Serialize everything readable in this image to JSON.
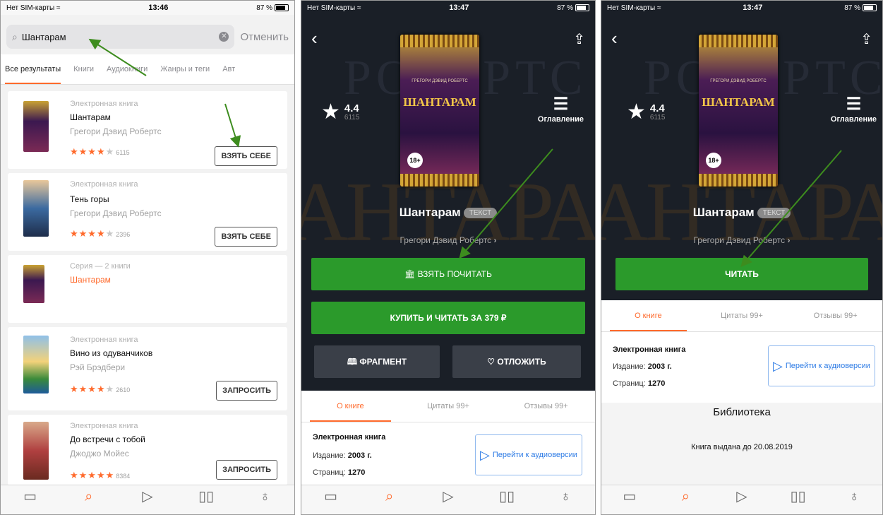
{
  "screen1": {
    "status": {
      "carrier": "Нет SIM-карты",
      "time": "13:46",
      "battery": "87 %"
    },
    "search": {
      "query": "Шантарам",
      "cancel": "Отменить"
    },
    "tabs": [
      "Все результаты",
      "Книги",
      "Аудиокниги",
      "Жанры и теги",
      "Авт"
    ],
    "results": [
      {
        "kind": "Электронная книга",
        "title": "Шантарам",
        "author": "Грегори Дэвид Робертс",
        "stars": "★★★★",
        "star_empty": "★",
        "count": "6115",
        "button": "ВЗЯТЬ СЕБЕ"
      },
      {
        "kind": "Электронная книга",
        "title": "Тень горы",
        "author": "Грегори Дэвид Робертс",
        "stars": "★★★★",
        "star_empty": "★",
        "count": "2396",
        "button": "ВЗЯТЬ СЕБЕ"
      },
      {
        "kind": "Серия — 2 книги",
        "title": "Шантарам"
      },
      {
        "kind": "Электронная книга",
        "title": "Вино из одуванчиков",
        "author": "Рэй Брэдбери",
        "stars": "★★★★",
        "star_empty": "★",
        "count": "2610",
        "button": "ЗАПРОСИТЬ"
      },
      {
        "kind": "Электронная книга",
        "title": "До встречи с тобой",
        "author": "Джоджо Мойес",
        "stars": "★★★★★",
        "star_empty": "",
        "count": "8384",
        "button": "ЗАПРОСИТЬ"
      }
    ]
  },
  "tabbar": {
    "active": 1
  },
  "book": {
    "title": "Шантарам",
    "tag": "ТЕКСТ",
    "author": "Грегори Дэвид Робертс",
    "rating": "4.4",
    "rating_count": "6115",
    "toc": "Оглавление",
    "cover_title": "ШАНТАРАМ",
    "cover_author": "ГРЕГОРИ ДЭВИД РОБЕРТС",
    "age": "18+",
    "bg_text": "АНТАРА",
    "bg_text2": "РОБЕРТС",
    "info_tabs": [
      "О книге",
      "Цитаты 99+",
      "Отзывы 99+"
    ],
    "kind": "Электронная книга",
    "edition_label": "Издание:",
    "edition": "2003 г.",
    "pages_label": "Страниц:",
    "pages": "1270",
    "audio_button": "Перейти к аудиоверсии"
  },
  "screen2": {
    "status": {
      "carrier": "Нет SIM-карты",
      "time": "13:47",
      "battery": "87 %"
    },
    "borrow_button": "ВЗЯТЬ ПОЧИТАТЬ",
    "buy_button": "КУПИТЬ И ЧИТАТЬ ЗА 379 ₽",
    "fragment_button": "ФРАГМЕНТ",
    "defer_button": "ОТЛОЖИТЬ"
  },
  "screen3": {
    "status": {
      "carrier": "Нет SIM-карты",
      "time": "13:47",
      "battery": "87 %"
    },
    "read_button": "ЧИТАТЬ",
    "library_title": "Библиотека",
    "library_note": "Книга выдана до 20.08.2019"
  },
  "colors": {
    "accent": "#ff6a2c",
    "green": "#2b9a2b",
    "arrow": "#3d8c1e",
    "link": "#2d7be5"
  }
}
